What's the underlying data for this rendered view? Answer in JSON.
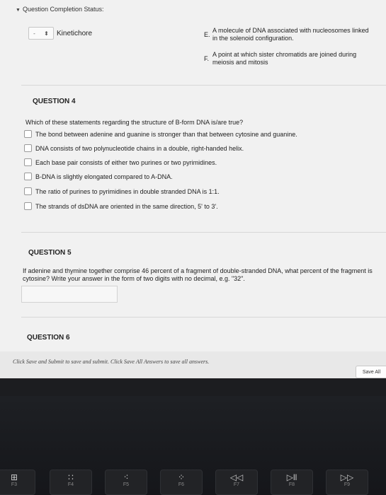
{
  "header": {
    "status_title": "Question Completion Status:"
  },
  "matching": {
    "select_value": "-",
    "select_label": "Kinetichore",
    "options": [
      {
        "letter": "E.",
        "text": "A molecule of DNA associated with nucleosomes linked in the solenoid configuration."
      },
      {
        "letter": "F.",
        "text": "A point at which sister chromatids are joined during meiosis and mitosis"
      }
    ]
  },
  "question4": {
    "title": "QUESTION 4",
    "prompt": "Which of these statements regarding the structure of B-form DNA is/are true?",
    "choices": [
      "The bond between adenine and guanine is stronger than that between cytosine and guanine.",
      "DNA consists of two polynucleotide chains in a double, right-handed helix.",
      "Each base pair consists of either two purines or two pyrimidines.",
      "B-DNA is slightly elongated compared to A-DNA.",
      "The ratio of purines to pyrimidines in double stranded DNA is 1:1.",
      "The strands of dsDNA are oriented in the same direction, 5' to 3'."
    ]
  },
  "question5": {
    "title": "QUESTION 5",
    "prompt": "If adenine and thymine together comprise 46 percent of a fragment of double-stranded DNA, what percent of the fragment is cytosine? Write your answer in the form of two digits with no decimal, e.g. \"32\".",
    "answer_value": ""
  },
  "question6": {
    "title": "QUESTION 6"
  },
  "footer": {
    "instruction": "Click Save and Submit to save and submit. Click Save All Answers to save all answers.",
    "save_all_label": "Save All"
  },
  "keyboard": {
    "keys": [
      {
        "glyph": "⊞",
        "label": "F3"
      },
      {
        "glyph": "∷",
        "label": "F4"
      },
      {
        "glyph": "⁖",
        "label": "F5"
      },
      {
        "glyph": "⁘",
        "label": "F6"
      },
      {
        "glyph": "◁◁",
        "label": "F7"
      },
      {
        "glyph": "▷ll",
        "label": "F8"
      },
      {
        "glyph": "▷▷",
        "label": "F9"
      }
    ]
  }
}
